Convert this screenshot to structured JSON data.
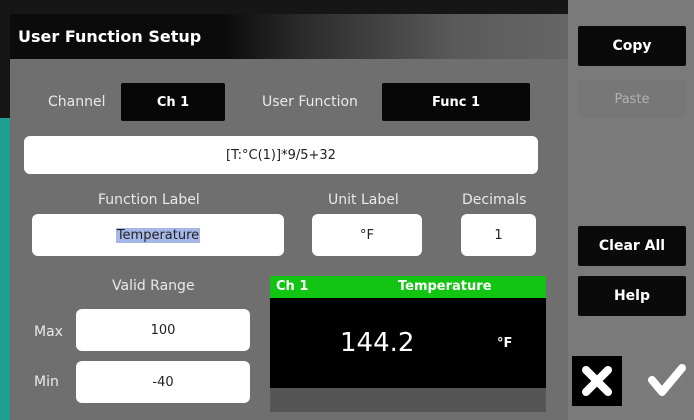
{
  "window": {
    "title": "User Function Setup"
  },
  "sidebar": {
    "copy": "Copy",
    "paste": "Paste",
    "clear_all": "Clear All",
    "help": "Help",
    "cancel_icon": "close-icon",
    "ok_icon": "check-icon"
  },
  "form": {
    "channel_label": "Channel",
    "channel_value": "Ch 1",
    "user_function_label": "User Function",
    "user_function_value": "Func 1",
    "expression": "[T:°C(1)]*9/5+32",
    "function_label_caption": "Function Label",
    "function_label_value": "Temperature",
    "unit_label_caption": "Unit Label",
    "unit_label_value": "°F",
    "decimals_caption": "Decimals",
    "decimals_value": "1",
    "valid_range_caption": "Valid Range",
    "max_label": "Max",
    "max_value": "100",
    "min_label": "Min",
    "min_value": "-40"
  },
  "preview": {
    "channel": "Ch 1",
    "label": "Temperature",
    "value": "144.2",
    "unit": "°F"
  },
  "colors": {
    "accent_green": "#13c513",
    "teal": "#1f9e93",
    "selection": "#a6b8e8"
  }
}
